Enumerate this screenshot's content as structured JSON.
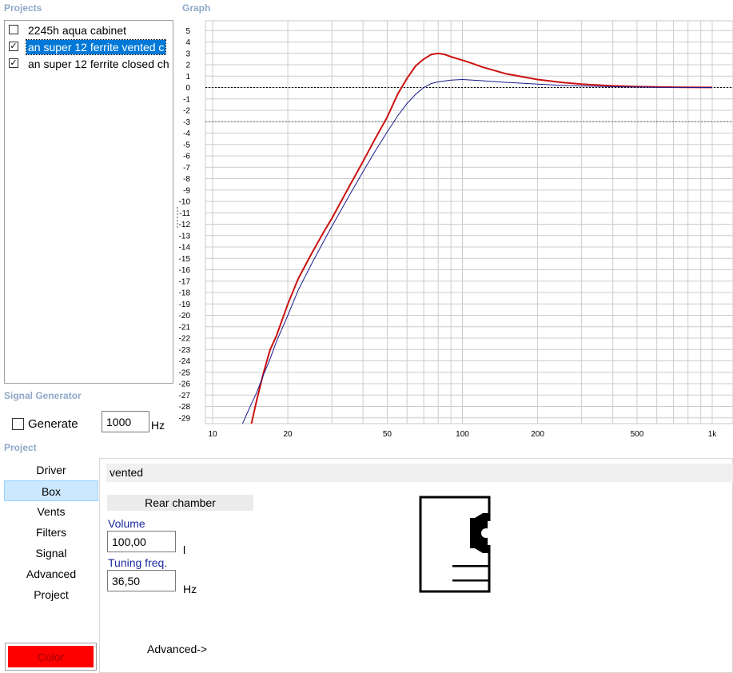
{
  "projects": {
    "title": "Projects",
    "items": [
      {
        "label": "2245h aqua cabinet",
        "checked": false,
        "selected": false
      },
      {
        "label": "an super 12 ferrite vented c",
        "checked": true,
        "selected": true
      },
      {
        "label": "an super 12 ferrite closed ch",
        "checked": true,
        "selected": false
      }
    ]
  },
  "graph": {
    "title": "Graph"
  },
  "chart_data": {
    "type": "line",
    "xscale": "log",
    "xlim": [
      10,
      1000
    ],
    "ylim": [
      -30,
      6
    ],
    "y_ticks": [
      5,
      4,
      3,
      2,
      1,
      0,
      -1,
      -2,
      -3,
      -4,
      -5,
      -6,
      -7,
      -8,
      -9,
      -10,
      -11,
      -12,
      -13,
      -14,
      -15,
      -16,
      -17,
      -18,
      -19,
      -20,
      -21,
      -22,
      -23,
      -24,
      -25,
      -26,
      -27,
      -28,
      -29
    ],
    "x_tick_labels": [
      {
        "value": 10,
        "label": "10"
      },
      {
        "value": 20,
        "label": "20"
      },
      {
        "value": 50,
        "label": "50"
      },
      {
        "value": 100,
        "label": "100"
      },
      {
        "value": 200,
        "label": "200"
      },
      {
        "value": 500,
        "label": "500"
      },
      {
        "value": 1000,
        "label": "1k"
      }
    ],
    "reference_lines": [
      0,
      -3
    ],
    "grid": true,
    "series": [
      {
        "color": "#cc1111",
        "x": [
          14.2,
          15,
          16,
          17,
          18,
          20,
          22,
          25,
          28,
          30,
          35,
          40,
          45,
          50,
          55,
          60,
          65,
          70,
          75,
          80,
          85,
          90,
          100,
          110,
          120,
          150,
          200,
          250,
          300,
          400,
          500,
          600,
          700,
          800,
          1000
        ],
        "y": [
          -29.8,
          -27.5,
          -25,
          -23,
          -21.8,
          -19,
          -16.8,
          -14.5,
          -12.6,
          -11.5,
          -8.8,
          -6.5,
          -4.4,
          -2.6,
          -0.6,
          0.8,
          1.9,
          2.5,
          2.9,
          3,
          2.9,
          2.7,
          2.4,
          2.1,
          1.8,
          1.2,
          0.7,
          0.45,
          0.3,
          0.15,
          0.08,
          0.05,
          0.03,
          0.02,
          0.01
        ]
      },
      {
        "color": "#1a1a8c",
        "x": [
          13,
          14,
          15,
          16,
          17,
          18,
          20,
          22,
          25,
          28,
          30,
          35,
          40,
          45,
          50,
          55,
          60,
          65,
          70,
          75,
          80,
          90,
          100,
          110,
          120,
          150,
          200,
          250,
          300,
          400,
          500,
          600,
          800,
          1000
        ],
        "y": [
          -29.8,
          -28.2,
          -26.8,
          -25.2,
          -23.8,
          -22.3,
          -20,
          -17.8,
          -15.4,
          -13.4,
          -12.2,
          -9.6,
          -7.4,
          -5.5,
          -3.9,
          -2.5,
          -1.4,
          -0.6,
          0,
          0.35,
          0.5,
          0.65,
          0.7,
          0.65,
          0.6,
          0.45,
          0.3,
          0.2,
          0.13,
          0.07,
          0.04,
          0.02,
          0.01,
          0.0
        ]
      }
    ]
  },
  "signal_generator": {
    "title": "Signal Generator",
    "generate_label": "Generate",
    "generate_checked": false,
    "frequency": "1000",
    "unit": "Hz"
  },
  "project": {
    "title": "Project",
    "nav": [
      {
        "label": "Driver",
        "active": false
      },
      {
        "label": "Box",
        "active": true
      },
      {
        "label": "Vents",
        "active": false
      },
      {
        "label": "Filters",
        "active": false
      },
      {
        "label": "Signal",
        "active": false
      },
      {
        "label": "Advanced",
        "active": false
      },
      {
        "label": "Project",
        "active": false
      }
    ],
    "color_button": {
      "label": "Color",
      "color": "#ff0000"
    }
  },
  "box": {
    "type": "vented",
    "rear_chamber_label": "Rear chamber",
    "volume_label": "Volume",
    "volume_value": "100,00",
    "volume_unit": "l",
    "tuning_label": "Tuning freq.",
    "tuning_value": "36,50",
    "tuning_unit": "Hz",
    "advanced_link": "Advanced->"
  },
  "colors": {
    "accent_selection": "#0078d7",
    "section_title": "#8fa8c8",
    "field_label": "#1a2aa0"
  }
}
